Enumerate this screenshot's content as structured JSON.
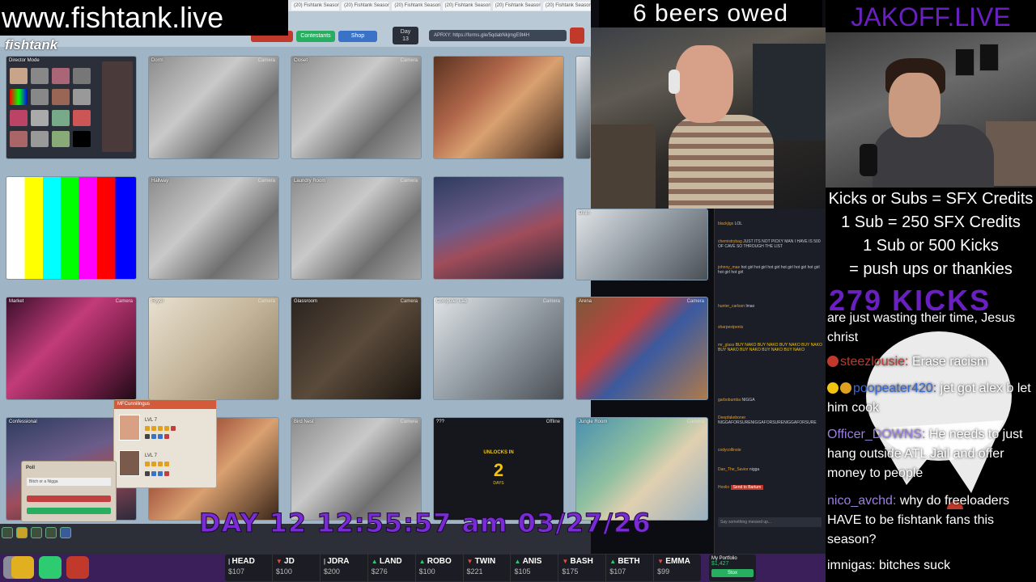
{
  "overlays": {
    "site_banner": "www.fishtank.live",
    "beers_owed": "6 beers owed",
    "jakoff": "JAKOFF.LIVE",
    "credits": [
      "Kicks or Subs = SFX Credits",
      "1 Sub = 250 SFX Credits",
      "1 Sub or 500 Kicks",
      "= push ups or thankies"
    ],
    "kicks_counter": "279 KICKS",
    "day_clock": "DAY 12  12:55:57 am  03/27/26"
  },
  "app": {
    "brand": "fishtank",
    "buttons": {
      "contestants": "Contestants",
      "shop": "Shop"
    },
    "day_pill": {
      "label": "Day",
      "value": "13"
    },
    "url": "APRXY: https://forms.gle/5qdabNkjmgE9t4H"
  },
  "browser_tabs": [
    "(20) Fishtank Season...",
    "(20) Fishtank Season...",
    "(20) Fishtank Season...",
    "(20) Fishtank Season...",
    "(20) Fishtank Season...",
    "(20) Fishtank Season...",
    "(20) Fishtank Season..."
  ],
  "cameras": [
    {
      "label": "Director Mode",
      "tag": ""
    },
    {
      "label": "Dorm",
      "tag": "Camera"
    },
    {
      "label": "Closet",
      "tag": "Camera"
    },
    {
      "label": "",
      "tag": ""
    },
    {
      "label": "",
      "tag": ""
    },
    {
      "label": "",
      "tag": ""
    },
    {
      "label": "Hallway",
      "tag": "Camera"
    },
    {
      "label": "Laundry Room",
      "tag": "Camera"
    },
    {
      "label": "",
      "tag": ""
    },
    {
      "label": "Dinin",
      "tag": ""
    },
    {
      "label": "Market",
      "tag": "Camera"
    },
    {
      "label": "Foyer",
      "tag": "Camera"
    },
    {
      "label": "Glassroom",
      "tag": "Camera"
    },
    {
      "label": "Computer Lab",
      "tag": "Camera"
    },
    {
      "label": "Arena",
      "tag": "Camera"
    },
    {
      "label": "Confessional",
      "tag": ""
    },
    {
      "label": "",
      "tag": ""
    },
    {
      "label": "Bird Nest",
      "tag": "Camera"
    },
    {
      "label": "???",
      "tag": "Offline"
    },
    {
      "label": "Jungle Room",
      "tag": "Camera"
    }
  ],
  "unlock": {
    "text": "UNLOCKS IN",
    "number": "2",
    "unit": "DAYS"
  },
  "popup": {
    "title": "MFCunnilingus",
    "level1": "LVL 7",
    "level2": "LVL 7"
  },
  "poll": {
    "title": "Poll",
    "question": "Bitch or a Nigga"
  },
  "app_chat": [
    {
      "user": "blackjigs",
      "msg": "LOL"
    },
    {
      "user": "chemistrybag",
      "msg": "JUST ITS NOT PICKY MAN I HAVE IS 500 OF CAVE SO THROUGH THE LIST"
    },
    {
      "user": "johnny_mae",
      "msg": "hot girl hot girl hot girl hot girl hot girl hot girl hot girl hot girl"
    },
    {
      "user": "hunter_carlson",
      "msg": "lmao"
    },
    {
      "user": "sharpestpenis",
      "msg": ""
    },
    {
      "user": "mr_glass",
      "msg": "BUY NAKO BUY NAKO BUY NAKO BUY NAKO BUY NAKO BUY NAKO BUY NAKO BUY NAKO"
    },
    {
      "user": "garbobumba",
      "msg": "NIGGA"
    },
    {
      "user": "Deepfakeboner",
      "msg": "NIGGAFORSURENIGGAFORSURENIGGAFORSURE"
    },
    {
      "user": "codycollinste",
      "msg": ""
    },
    {
      "user": "Dan_The_Savior",
      "msg": "nigga"
    },
    {
      "user": "Hoolio",
      "msg": "Send to Bartum"
    }
  ],
  "app_chat_input": "Say something messed up...",
  "stocks": [
    {
      "name": "HEAD",
      "dir": "flat",
      "price": "$107"
    },
    {
      "name": "JD",
      "dir": "down",
      "price": "$100"
    },
    {
      "name": "JDRA",
      "dir": "flat",
      "price": "$200"
    },
    {
      "name": "LAND",
      "dir": "up",
      "price": "$276"
    },
    {
      "name": "ROBO",
      "dir": "up",
      "price": "$100"
    },
    {
      "name": "TWIN",
      "dir": "down",
      "price": "$221"
    },
    {
      "name": "ANIS",
      "dir": "up",
      "price": "$105"
    },
    {
      "name": "BASH",
      "dir": "down",
      "price": "$175"
    },
    {
      "name": "BETH",
      "dir": "up",
      "price": "$107"
    },
    {
      "name": "EMMA",
      "dir": "down",
      "price": "$99"
    }
  ],
  "portfolio": {
    "label": "My Portfolio",
    "value": "$1,427",
    "button": "Stox"
  },
  "stream_chat": [
    {
      "user": "",
      "msg": "are just wasting their time, Jesus christ"
    },
    {
      "user": "steezlousie:",
      "msg": " Erase racism"
    },
    {
      "user": "poopeater420:",
      "msg": " jet got alex b let him cook"
    },
    {
      "user": "Officer_DOWNS:",
      "msg": " He needs to just hang outside ATL Jail and offer money to people"
    },
    {
      "user": "nico_avchd:",
      "msg": " why do freeloaders HAVE to be fishtank fans this season?"
    },
    {
      "user": "imnigas:",
      "msg": " bitches suck"
    }
  ],
  "colors": {
    "accent": "#6a1fc0",
    "ticker_bg": "#3a1f5a",
    "app_bg": "#9fb4c4"
  }
}
